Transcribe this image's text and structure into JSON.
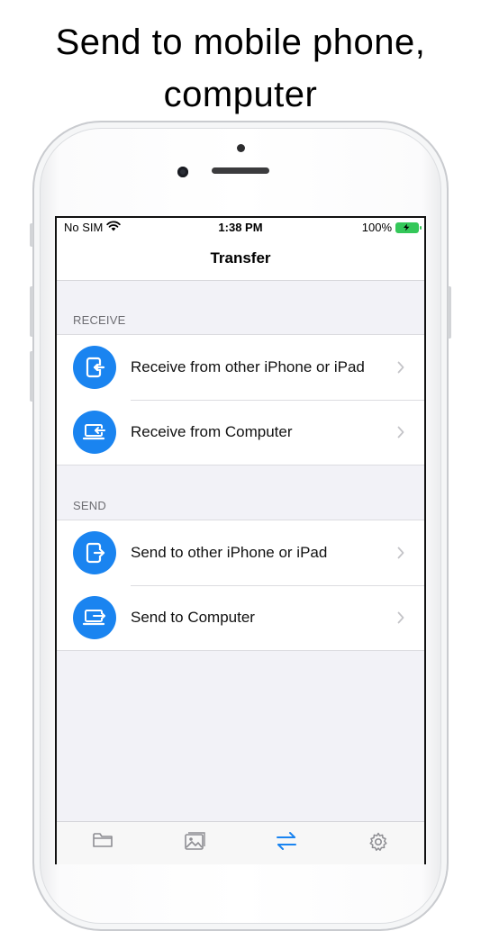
{
  "headline": {
    "line1": "Send to mobile phone,",
    "line2": "computer"
  },
  "status_bar": {
    "carrier": "No SIM",
    "time": "1:38 PM",
    "battery_percent": "100%",
    "battery_color": "#34c759"
  },
  "nav": {
    "title": "Transfer"
  },
  "sections": {
    "receive": {
      "header": "RECEIVE",
      "items": [
        {
          "label": "Receive from other iPhone or iPad",
          "icon": "phone-receive-icon"
        },
        {
          "label": "Receive from Computer",
          "icon": "computer-receive-icon"
        }
      ]
    },
    "send": {
      "header": "SEND",
      "items": [
        {
          "label": "Send to other iPhone or iPad",
          "icon": "phone-send-icon"
        },
        {
          "label": "Send to Computer",
          "icon": "computer-send-icon"
        }
      ]
    }
  },
  "tab_bar": {
    "tabs": [
      {
        "icon": "folder-icon",
        "selected": false
      },
      {
        "icon": "photo-icon",
        "selected": false
      },
      {
        "icon": "transfer-arrows-icon",
        "selected": true
      },
      {
        "icon": "gear-icon",
        "selected": false
      }
    ],
    "accent_color": "#1a84f0",
    "inactive_color": "#8e8e93"
  }
}
